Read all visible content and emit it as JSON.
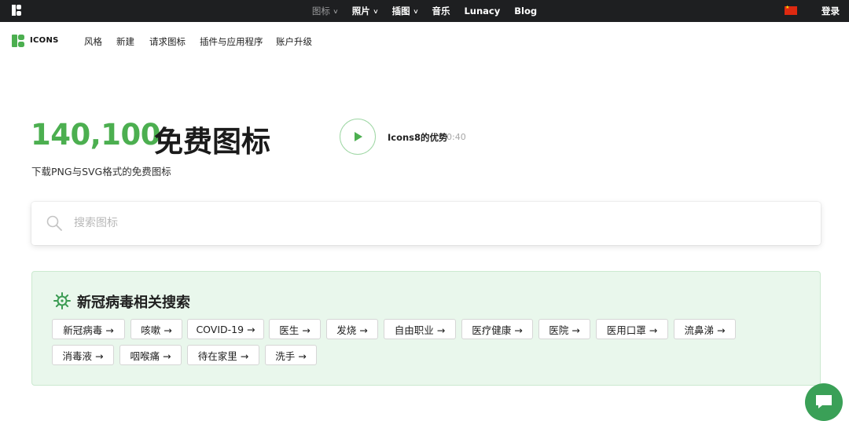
{
  "topbar": {
    "nav": [
      {
        "label": "图标",
        "dropdown": true,
        "active": true
      },
      {
        "label": "照片",
        "dropdown": true
      },
      {
        "label": "插图",
        "dropdown": true
      },
      {
        "label": "音乐",
        "dropdown": false
      },
      {
        "label": "Lunacy",
        "dropdown": false
      },
      {
        "label": "Blog",
        "dropdown": false
      }
    ],
    "login": "登录"
  },
  "brand": {
    "text": "ICONS",
    "accent": "#4caf50"
  },
  "subnav": [
    "风格",
    "新建",
    "请求图标",
    "插件与应用程序",
    "账户升级"
  ],
  "hero": {
    "count": "140,100",
    "title": "免费图标",
    "subtitle": "下载PNG与SVG格式的免费图标",
    "video_label": "Icons8的优势",
    "video_duration": "0:40"
  },
  "search": {
    "placeholder": "搜索图标",
    "value": ""
  },
  "covid": {
    "title": "新冠病毒相关搜索",
    "chips": [
      "新冠病毒 →",
      "咳嗽 →",
      "COVID-19 →",
      "医生 →",
      "发烧 →",
      "自由职业 →",
      "医疗健康 →",
      "医院 →",
      "医用口罩 →",
      "流鼻涕 →",
      "消毒液 →",
      "咽喉痛 →",
      "待在家里 →",
      "洗手 →"
    ]
  },
  "colors": {
    "accent": "#4caf50",
    "card_bg": "#e9f7ec",
    "topbar": "#1e1f21",
    "chat": "#3aa057"
  },
  "icons": [
    "logo-icon",
    "chevron-down-icon",
    "flag-cn-icon",
    "play-icon",
    "search-icon",
    "virus-icon",
    "chat-icon"
  ]
}
